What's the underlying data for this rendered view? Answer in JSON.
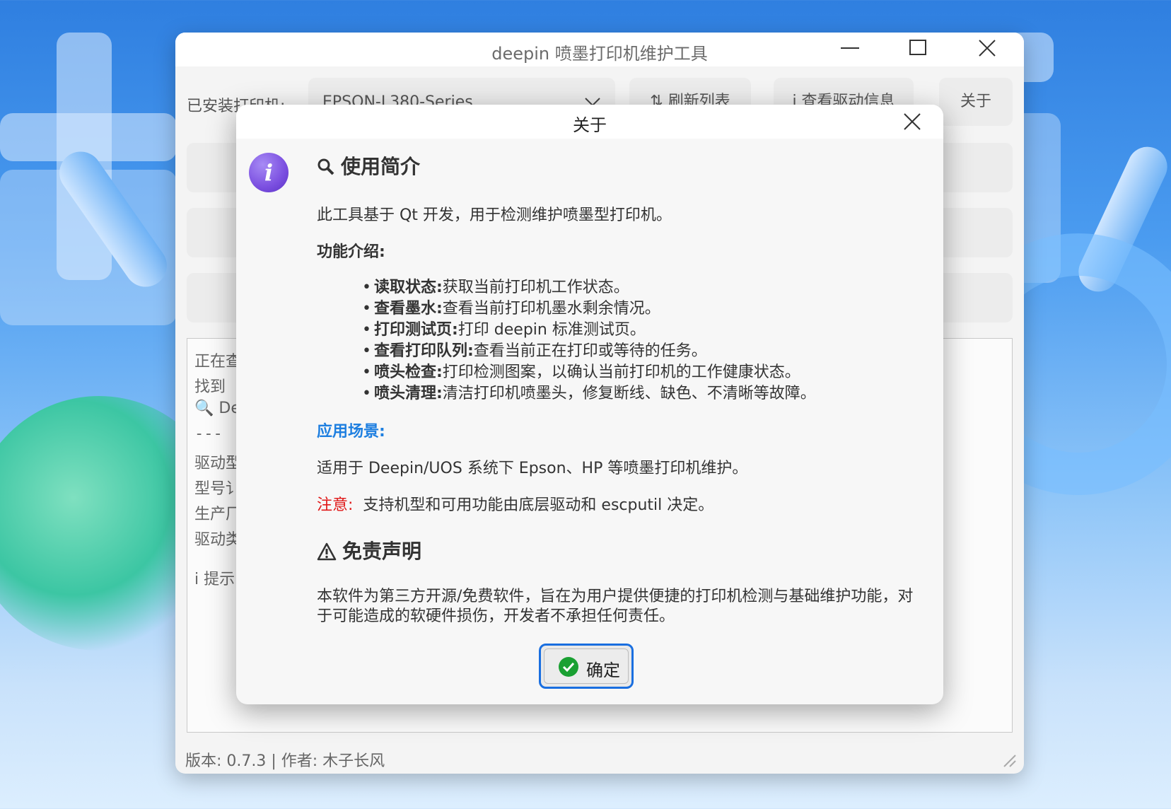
{
  "window": {
    "title": "deepin 喷墨打印机维护工具",
    "minimize_icon": "minimize-icon",
    "maximize_icon": "maximize-icon",
    "close_icon": "close-icon"
  },
  "toolbar": {
    "printer_label": "已安装打印机:",
    "printer_value": "EPSON-L380-Series",
    "refresh_label": "⇅ 刷新列表",
    "driver_info_label": "i 查看驱动信息",
    "about_label": "关于"
  },
  "log": {
    "lines": [
      "正在查",
      "找到",
      "🔍 De",
      "--- ",
      "驱动型",
      "型号讠",
      "生产厂",
      "驱动类",
      "i 提示"
    ]
  },
  "statusbar": {
    "text": "版本: 0.7.3 | 作者: 木子长风"
  },
  "dialog": {
    "title": "关于",
    "info_icon": "i",
    "intro_heading": "使用简介",
    "intro_text": "此工具基于 Qt 开发，用于检测维护喷墨型打印机。",
    "features_heading": "功能介绍:",
    "features": [
      {
        "name": "读取状态:",
        "desc": "获取当前打印机工作状态。"
      },
      {
        "name": "查看墨水:",
        "desc": "查看当前打印机墨水剩余情况。"
      },
      {
        "name": "打印测试页:",
        "desc": "打印 deepin 标准测试页。"
      },
      {
        "name": "查看打印队列:",
        "desc": "查看当前正在打印或等待的任务。"
      },
      {
        "name": "喷头检查:",
        "desc": "打印检测图案，以确认当前打印机的工作健康状态。"
      },
      {
        "name": "喷头清理:",
        "desc": "清洁打印机喷墨头，修复断线、缺色、不清晰等故障。"
      }
    ],
    "scenario_heading": "应用场景:",
    "scenario_text": "适用于 Deepin/UOS 系统下 Epson、HP 等喷墨打印机维护。",
    "note_label": "注意:",
    "note_text": "支持机型和可用功能由底层驱动和 escputil 决定。",
    "disclaimer_heading": "免责声明",
    "disclaimer_text": "本软件为第三方开源/免费软件，旨在为用户提供便捷的打印机检测与基础维护功能，对于可能造成的软硬件损伤，开发者不承担任何责任。",
    "ok_label": "确定"
  },
  "colors": {
    "accent": "#1a6fe0",
    "scenario": "#1e7fe0",
    "note": "#e01818",
    "ok_check": "#1aa032"
  }
}
